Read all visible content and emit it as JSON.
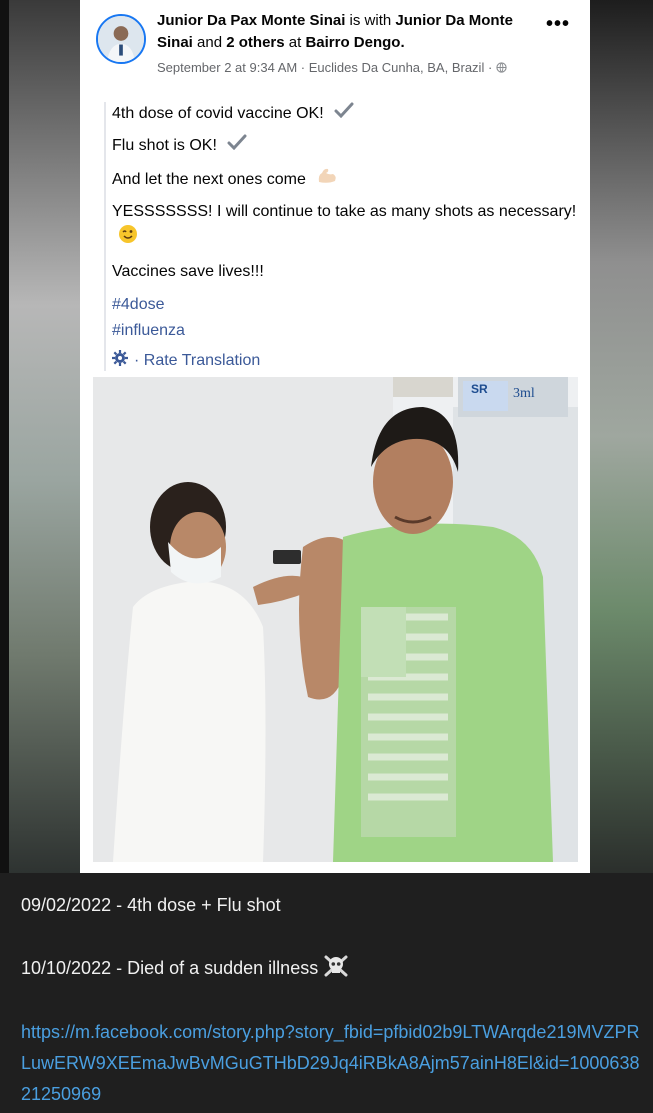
{
  "post": {
    "author": "Junior Da Pax Monte Sinai",
    "with_text": "is with",
    "tagged": "Junior Da Monte Sinai",
    "and_text": "and",
    "others": "2 others",
    "at_text": "at",
    "place": "Bairro Dengo.",
    "meta": "September 2 at 9:34 AM · Euclides Da Cunha, BA, Brazil ·",
    "more_label": "•••",
    "lines": [
      "4th dose of covid vaccine OK!",
      "Flu shot is OK!",
      "And let the next ones come",
      "YESSSSSSS! I will continue to take as many shots as necessary!",
      "Vaccines save lives!!!"
    ],
    "hashtags": [
      "#4dose",
      "#influenza"
    ],
    "rate_translation": "· Rate Translation",
    "photo_labels": [
      "SR",
      "3ml"
    ]
  },
  "caption": {
    "line1": "09/02/2022 - 4th dose + Flu shot",
    "line2": "10/10/2022 - Died of a sudden illness",
    "link": "https://m.facebook.com/story.php?story_fbid=pfbid02b9LTWArqde219MVZPRLuwERW9XEEmaJwBvMGuGTHbD29Jq4iRBkA8Ajm57ainH8El&id=100063821250969"
  },
  "colors": {
    "link": "#4a9fe0",
    "hashtag": "#3b5998",
    "avatar_ring": "#1877f2"
  }
}
